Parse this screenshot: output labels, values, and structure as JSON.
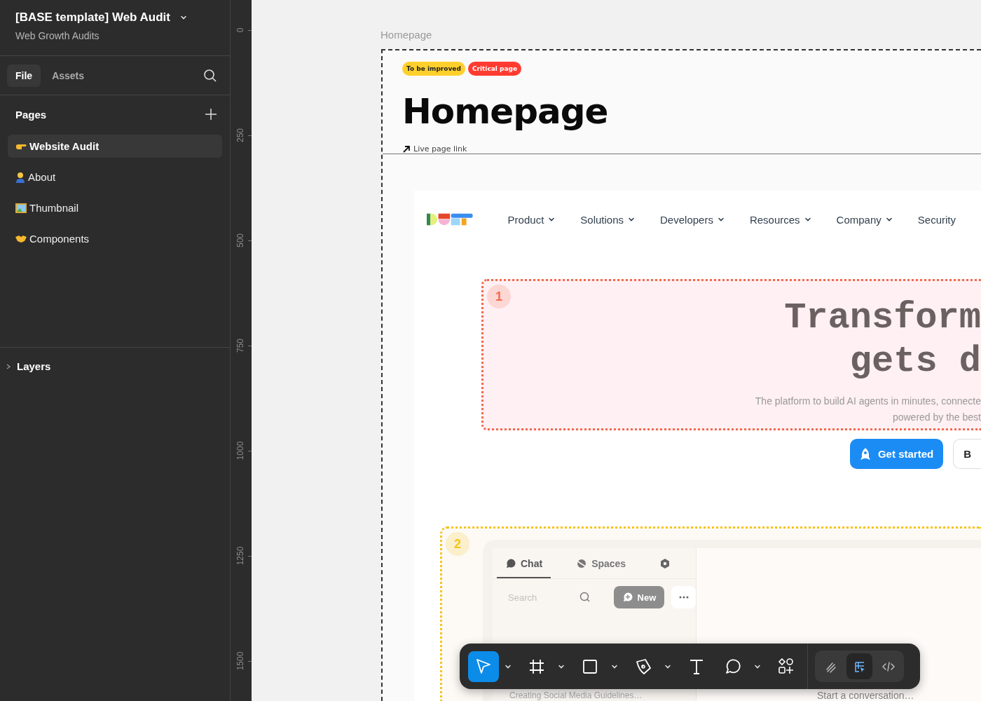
{
  "file": {
    "title": "[BASE template] Web Audit",
    "subtitle": "Web Growth Audits"
  },
  "panel_tabs": [
    {
      "label": "File",
      "selected": true
    },
    {
      "label": "Assets",
      "selected": false
    }
  ],
  "pages": {
    "title": "Pages",
    "items": [
      {
        "kind": "pointing-hand",
        "label": "Website Audit",
        "selected": true
      },
      {
        "kind": "person",
        "label": "About",
        "selected": false
      },
      {
        "kind": "picture",
        "label": "Thumbnail",
        "selected": false
      },
      {
        "kind": "handshake",
        "label": "Components",
        "selected": false
      }
    ]
  },
  "layers": {
    "title": "Layers",
    "expanded": false
  },
  "ruler": [
    "0",
    "250",
    "500",
    "750",
    "1000",
    "1250",
    "1500"
  ],
  "frame": {
    "label": "Homepage",
    "tags": [
      {
        "label": "To be improved",
        "color": "#ffd02b"
      },
      {
        "label": "Critical page",
        "color": "#ff3b30"
      }
    ],
    "title": "Homepage",
    "link": "Live page link",
    "nav": [
      {
        "label": "Product",
        "dropdown": true
      },
      {
        "label": "Solutions",
        "dropdown": true
      },
      {
        "label": "Developers",
        "dropdown": true
      },
      {
        "label": "Resources",
        "dropdown": true
      },
      {
        "label": "Company",
        "dropdown": true
      },
      {
        "label": "Security",
        "dropdown": false
      }
    ],
    "hero": {
      "number": "1",
      "color": "#f26b4f",
      "headline": [
        "Transform",
        "gets d"
      ],
      "subtitle": [
        "The platform to build AI agents in minutes, connecte",
        "powered by the best"
      ],
      "buttons": [
        {
          "kind": "primary",
          "label": "Get started"
        },
        {
          "kind": "secondary",
          "label": "B"
        }
      ]
    },
    "section_2": {
      "number": "2",
      "color": "#f5c518",
      "tabs": [
        {
          "kind": "chat",
          "label": "Chat",
          "selected": true
        },
        {
          "kind": "spaces",
          "label": "Spaces",
          "selected": false
        },
        {
          "kind": "settings",
          "selected": false
        }
      ],
      "search": {
        "placeholder": "Search"
      },
      "new_button": "New",
      "list_item": "Creating Social Media Guidelines…",
      "empty_state": "Start a conversation…"
    }
  },
  "toolbar": {
    "tools": [
      {
        "kind": "move",
        "selected": true,
        "dropdown": true
      },
      {
        "kind": "frame",
        "selected": false,
        "dropdown": true
      },
      {
        "kind": "rectangle",
        "selected": false,
        "dropdown": true
      },
      {
        "kind": "pen",
        "selected": false,
        "dropdown": true
      },
      {
        "kind": "text",
        "selected": false,
        "dropdown": false
      },
      {
        "kind": "comment",
        "selected": false,
        "dropdown": true
      },
      {
        "kind": "components",
        "selected": false,
        "dropdown": false
      }
    ],
    "modes": [
      {
        "kind": "draw",
        "selected": false
      },
      {
        "kind": "design",
        "selected": true
      },
      {
        "kind": "dev",
        "selected": false
      }
    ]
  }
}
